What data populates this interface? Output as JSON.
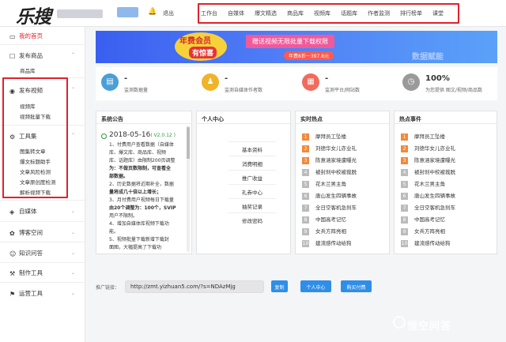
{
  "header": {
    "logo": "乐搜",
    "logout": "退出",
    "nav": [
      "工作台",
      "自媒体",
      "爆文精选",
      "商品库",
      "视频库",
      "话题库",
      "作者监测",
      "排行榜单",
      "课堂"
    ]
  },
  "sidebar": {
    "home": "我的首页",
    "groups": [
      {
        "label": "发布商品",
        "subs": [
          "商品库"
        ]
      },
      {
        "label": "发布视频",
        "subs": [
          "视频库",
          "视频批量下载"
        ]
      },
      {
        "label": "工具集",
        "subs": [
          "图集转文章",
          "爆文标题助手",
          "文章风险检测",
          "文章原创度检测",
          "解析视频下载"
        ]
      }
    ],
    "more": [
      "自媒体",
      "博客空间",
      "知识问答",
      "制作工具",
      "运营工具"
    ]
  },
  "banner": {
    "t1": "年费会员",
    "t2": "有惊喜",
    "pill": "赠送视频无限批量下载权限",
    "price": "年费8折一397.8元",
    "right": "数据赋能"
  },
  "stats": [
    {
      "num": "-",
      "label": "监测数据量",
      "color": "#4a9fd8",
      "icon": "chart-icon"
    },
    {
      "num": "-",
      "label": "监测自媒体作者数",
      "color": "#f0b429",
      "icon": "person-icon"
    },
    {
      "num": "-",
      "label": "监测平台/网站数",
      "color": "#f26b5b",
      "icon": "doc-icon"
    },
    {
      "num": "100%",
      "label": "为您提供 图文/视频/商品数",
      "color": "#9a9a9a",
      "icon": "clock-icon"
    }
  ],
  "notice": {
    "title": "系统公告",
    "date": "2018-05-16",
    "version": "( V2.0.12 )",
    "lines": [
      "1、付费用户查看数据（自媒体",
      "库、爆文库、商品库、视频",
      "库、话题库）由限制200页调整",
      "为：不做页数限制，可查看全",
      "部数据。",
      "2、历史数据将近期补全，数据",
      "量将成几十倍以上增长；",
      "3、月付费用户视频每日下载量",
      "由20个调整为：100个，SVIP",
      "用户不限制。",
      "4、增加自媒体库视频下载功",
      "能。",
      "5、视频批量下载新增下载封",
      "面图，大幅提高了下载功"
    ]
  },
  "personal": {
    "title": "个人中心",
    "items": [
      "基本资料",
      "消费明细",
      "推广收益",
      "礼券中心",
      "抽奖记录",
      "修改密码"
    ]
  },
  "realtime": {
    "title": "实时热点",
    "items": [
      "摩拜员工坠楼",
      "刘德华女儿亦业礼",
      "陈意涵家境遭曝光",
      "被封刹中校被裁脱",
      "花木兰男主角",
      "唐山发生四辆事故",
      "全日空客机急刹车",
      "中国高考记忆",
      "女兵方阵亮相",
      "建流感传动给狗"
    ]
  },
  "hotevents": {
    "title": "热点事件",
    "items": [
      "摩拜员工坠楼",
      "刘德华女儿亦业礼",
      "陈意涵家境遭曝光",
      "被封刹中校被裁脱",
      "花木兰男主角",
      "唐山发生四辆事故",
      "全日空客机急刹车",
      "中国高考记忆",
      "女兵方阵亮相",
      "建流感传动给狗"
    ]
  },
  "promo": {
    "label": "推广链接：",
    "url": "http://zmt.yizhuan5.com/?s=NDAzMjg",
    "copy": "复制",
    "center": "个人中心",
    "buy": "购买付费"
  },
  "watermark": "悟空问答"
}
